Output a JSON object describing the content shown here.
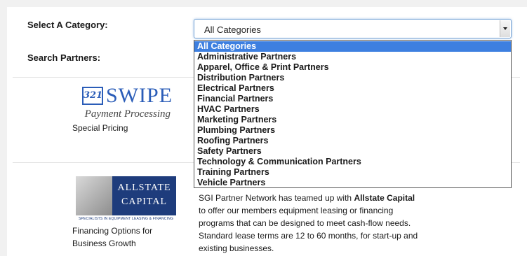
{
  "form": {
    "category_label": "Select A Category:",
    "search_label": "Search Partners:",
    "selected_value": "All Categories",
    "options": [
      "All Categories",
      "Administrative Partners",
      "Apparel, Office & Print Partners",
      "Distribution Partners",
      "Electrical Partners",
      "Financial Partners",
      "HVAC Partners",
      "Marketing Partners",
      "Plumbing Partners",
      "Roofing Partners",
      "Safety Partners",
      "Technology & Communication Partners",
      "Training Partners",
      "Vehicle Partners"
    ]
  },
  "partners": [
    {
      "logo_badge": "321",
      "logo_word": "SWIPE",
      "logo_sub": "Payment Processing",
      "caption": "Special Pricing"
    },
    {
      "logo_line1": "ALLSTATE",
      "logo_line2": "CAPITAL",
      "logo_tag": "SPECIALISTS IN EQUIPMENT LEASING & FINANCING",
      "caption_line1": "Financing Options for",
      "caption_line2": "Business Growth",
      "desc_prefix": "SGI Partner Network has teamed up with ",
      "desc_bold": "Allstate Capital",
      "desc_line2": "to offer our members equipment leasing or financing",
      "desc_line3": "programs that can be designed to meet cash-flow needs.",
      "desc_line4": "Standard lease terms are 12 to 60 months, for start-up and",
      "desc_line5": "existing businesses."
    }
  ],
  "colors": {
    "accent": "#3d7fe0",
    "swipe_blue": "#2b5db8",
    "allstate_navy": "#1e3c7c"
  }
}
